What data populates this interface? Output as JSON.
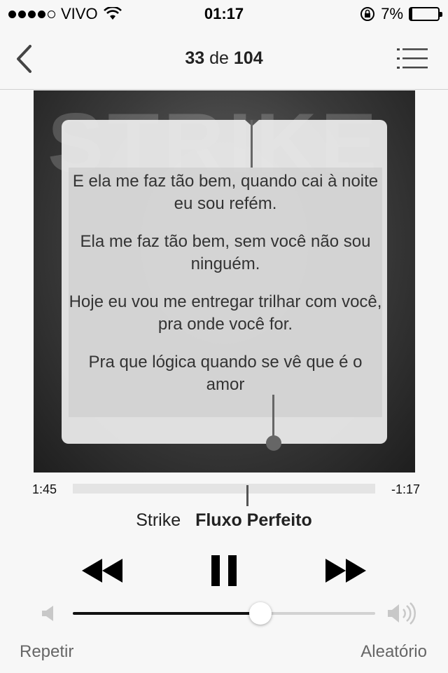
{
  "status_bar": {
    "carrier": "VIVO",
    "time": "01:17",
    "battery": "7%",
    "battery_level": 0.07,
    "signal_bars": 4,
    "icons": [
      "signal-icon",
      "wifi-icon",
      "rotation-lock-icon",
      "battery-icon"
    ]
  },
  "nav": {
    "current": "33",
    "separator": "de",
    "total": "104",
    "back_icon": "chevron-left-icon",
    "list_icon": "track-list-icon"
  },
  "lyrics": [
    "E ela me faz tão bem, quando cai à noite eu sou refém.",
    "Ela me faz tão bem, sem você não sou ninguém.",
    "Hoje eu vou me entregar trilhar com você, pra onde você for.",
    "Pra que lógica quando se vê que é o amor"
  ],
  "progress": {
    "elapsed": "1:45",
    "remaining": "-1:17",
    "fraction": 0.573
  },
  "song": {
    "artist": "Strike",
    "title": "Fluxo Perfeito"
  },
  "controls": {
    "prev_icon": "rewind-icon",
    "pause_icon": "pause-icon",
    "next_icon": "fast-forward-icon"
  },
  "volume": {
    "level": 0.62,
    "low_icon": "speaker-low-icon",
    "high_icon": "speaker-high-icon"
  },
  "bottom": {
    "repeat": "Repetir",
    "shuffle": "Aleatório"
  }
}
